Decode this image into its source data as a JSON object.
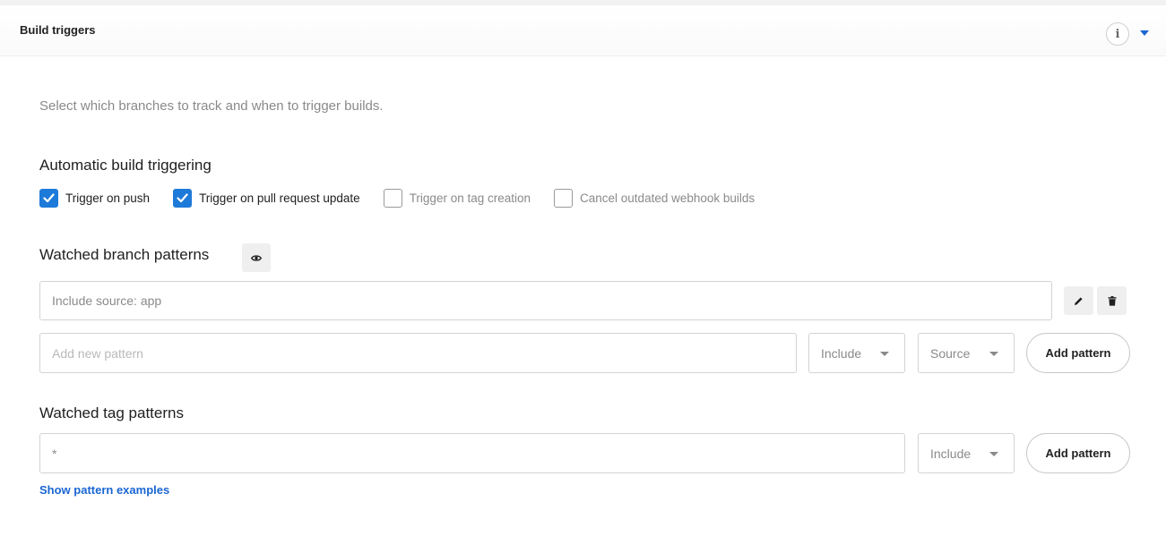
{
  "header": {
    "title": "Build triggers",
    "info_glyph": "i",
    "info_icon": "info-icon",
    "collapse_icon": "caret-down-icon",
    "accent_color": "#1a66d2"
  },
  "description": "Select which branches to track and when to trigger builds.",
  "automatic": {
    "heading": "Automatic build triggering",
    "checkboxes": [
      {
        "label": "Trigger on push",
        "checked": true
      },
      {
        "label": "Trigger on pull request update",
        "checked": true
      },
      {
        "label": "Trigger on tag creation",
        "checked": false
      },
      {
        "label": "Cancel outdated webhook builds",
        "checked": false
      }
    ],
    "checkbox_color": "#1e7ad9"
  },
  "branch_patterns": {
    "heading": "Watched branch patterns",
    "visibility_icon": "eye-icon",
    "existing": [
      {
        "text": "Include source: app",
        "edit_icon": "pencil-icon",
        "delete_icon": "trash-icon"
      }
    ],
    "new_placeholder": "Add new pattern",
    "mode_select": "Include",
    "type_select": "Source",
    "add_button": "Add pattern"
  },
  "tag_patterns": {
    "heading": "Watched tag patterns",
    "value": "*",
    "mode_select": "Include",
    "add_button": "Add pattern"
  },
  "examples_link": "Show pattern examples"
}
